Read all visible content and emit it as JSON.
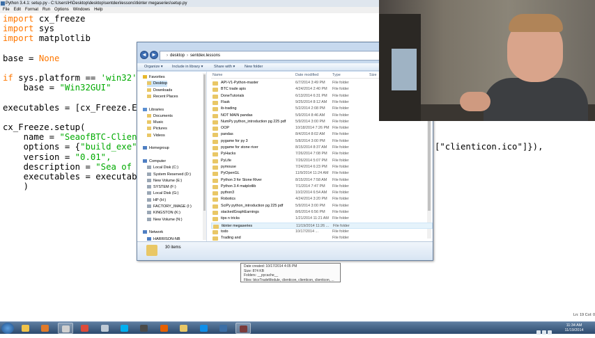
{
  "idle": {
    "title": "Python 3.4.1: setup.py - C:\\Users\\H\\Desktop\\desktop\\sentdex\\lessons\\tkinter megaseries\\setup.py",
    "menu": [
      "File",
      "Edit",
      "Format",
      "Run",
      "Options",
      "Windows",
      "Help"
    ],
    "code_lines": [
      {
        "kw": "import",
        "rest": " cx_freeze"
      },
      {
        "kw": "import",
        "rest": " sys"
      },
      {
        "kw": "import",
        "rest": " matplotlib"
      },
      {
        "kw": "",
        "rest": ""
      },
      {
        "kw": "",
        "rest": "base = ",
        "kw2": "None"
      },
      {
        "kw": "",
        "rest": ""
      },
      {
        "kw": "if",
        "rest": " sys.platform == ",
        "str": "'win32'"
      },
      {
        "kw": "",
        "rest": "    base = ",
        "str": "\"Win32GUI\""
      },
      {
        "kw": "",
        "rest": ""
      },
      {
        "kw": "",
        "rest": "executables = [cx_Freeze.E"
      },
      {
        "kw": "",
        "rest": ""
      },
      {
        "kw": "",
        "rest": "cx_Freeze.setup("
      },
      {
        "kw": "",
        "rest": "    name = ",
        "str": "\"SeaofBTC-Clien"
      },
      {
        "kw": "",
        "rest": "    options = {",
        "str": "\"build_exe\""
      },
      {
        "kw": "",
        "rest": "    version = ",
        "str": "\"0.01\","
      },
      {
        "kw": "",
        "rest": "    description = ",
        "str": "\"Sea of"
      },
      {
        "kw": "",
        "rest": "    executables = executab"
      },
      {
        "kw": "",
        "rest": "    )"
      }
    ],
    "code_extra": "[\"clienticon.ico\"]}),",
    "status_line": "Ln: 19 Col: 0"
  },
  "explorer": {
    "nav_back": "◄",
    "nav_fwd": "►",
    "address": [
      "desktop",
      "sentdex.lessons"
    ],
    "toolbar": [
      "Organize ▾",
      "Include in library ▾",
      "Share with ▾",
      "New folder"
    ],
    "nav_items": [
      {
        "label": "Favorites",
        "icon": "star-icon",
        "level": 0
      },
      {
        "label": "Desktop",
        "icon": "desktop-icon",
        "level": 1,
        "selected": true
      },
      {
        "label": "Downloads",
        "icon": "downloads-icon",
        "level": 1
      },
      {
        "label": "Recent Places",
        "icon": "recent-places-icon",
        "level": 1
      },
      {
        "label": "",
        "icon": "",
        "level": 0
      },
      {
        "label": "Libraries",
        "icon": "libraries-icon",
        "level": 0
      },
      {
        "label": "Documents",
        "icon": "documents-icon",
        "level": 1
      },
      {
        "label": "Music",
        "icon": "music-icon",
        "level": 1
      },
      {
        "label": "Pictures",
        "icon": "pictures-icon",
        "level": 1
      },
      {
        "label": "Videos",
        "icon": "videos-icon",
        "level": 1
      },
      {
        "label": "",
        "icon": "",
        "level": 0
      },
      {
        "label": "Homegroup",
        "icon": "homegroup-icon",
        "level": 0
      },
      {
        "label": "",
        "icon": "",
        "level": 0
      },
      {
        "label": "Computer",
        "icon": "computer-icon",
        "level": 0
      },
      {
        "label": "Local Disk (C:)",
        "icon": "drive-icon",
        "level": 1
      },
      {
        "label": "System Reserved (D:)",
        "icon": "drive-icon",
        "level": 1
      },
      {
        "label": "New Volume (E:)",
        "icon": "drive-icon",
        "level": 1
      },
      {
        "label": "SYSTEM (F:)",
        "icon": "drive-icon",
        "level": 1
      },
      {
        "label": "Local Disk (G:)",
        "icon": "drive-icon",
        "level": 1
      },
      {
        "label": "HP (H:)",
        "icon": "drive-icon",
        "level": 1
      },
      {
        "label": "FACTORY_IMAGE (I:)",
        "icon": "drive-icon",
        "level": 1
      },
      {
        "label": "KINGSTON (K:)",
        "icon": "drive-icon",
        "level": 1
      },
      {
        "label": "New Volume (N:)",
        "icon": "drive-icon",
        "level": 1
      },
      {
        "label": "",
        "icon": "",
        "level": 0
      },
      {
        "label": "Network",
        "icon": "network-icon",
        "level": 0
      },
      {
        "label": "HARRISON-NB",
        "icon": "computer-icon",
        "level": 1
      }
    ],
    "columns": {
      "name": "Name",
      "date": "Date modified",
      "type": "Type",
      "size": "Size"
    },
    "files": [
      {
        "name": "API-V1-Python-master",
        "date": "6/7/2014 3:49 PM",
        "type": "File folder"
      },
      {
        "name": "BTC trade apis",
        "date": "4/24/2014 2:40 PM",
        "type": "File folder"
      },
      {
        "name": "DoneTutorials",
        "date": "6/13/2014 6:31 PM",
        "type": "File folder"
      },
      {
        "name": "Flask",
        "date": "9/25/2014 8:12 AM",
        "type": "File folder"
      },
      {
        "name": "ib-trading",
        "date": "5/2/2014 2:08 PM",
        "type": "File folder"
      },
      {
        "name": "NOT MAIN pandas",
        "date": "5/9/2014 8:46 AM",
        "type": "File folder"
      },
      {
        "name": "NumPy python_introduction pg 225 pdf",
        "date": "5/9/2014 3:00 PM",
        "type": "File folder"
      },
      {
        "name": "OOP",
        "date": "10/18/2014 7:26 PM",
        "type": "File folder"
      },
      {
        "name": "pandas",
        "date": "8/4/2014 8:02 AM",
        "type": "File folder"
      },
      {
        "name": "pygame for py 3",
        "date": "5/8/2014 3:00 PM",
        "type": "File folder"
      },
      {
        "name": "pygame for stone river",
        "date": "8/15/2014 8:37 AM",
        "type": "File folder"
      },
      {
        "name": "PyHacks",
        "date": "7/26/2014 7:08 PM",
        "type": "File folder"
      },
      {
        "name": "PyLife",
        "date": "7/26/2014 5:07 PM",
        "type": "File folder"
      },
      {
        "name": "pymouse",
        "date": "7/24/2014 6:23 PM",
        "type": "File folder"
      },
      {
        "name": "PyOpenGL",
        "date": "11/9/2014 11:24 AM",
        "type": "File folder"
      },
      {
        "name": "Python 3 for Stone River",
        "date": "8/15/2014 7:58 AM",
        "type": "File folder"
      },
      {
        "name": "Python 3.4 matplotlib",
        "date": "7/1/2014 7:47 PM",
        "type": "File folder"
      },
      {
        "name": "python3",
        "date": "10/2/2014 6:54 AM",
        "type": "File folder"
      },
      {
        "name": "Robotics",
        "date": "4/24/2014 3:20 PM",
        "type": "File folder"
      },
      {
        "name": "SciPy python_introduction pg 225 pdf",
        "date": "5/9/2014 3:00 PM",
        "type": "File folder"
      },
      {
        "name": "stackedGraphEarnings",
        "date": "8/6/2014 6:56 PM",
        "type": "File folder"
      },
      {
        "name": "tips n tricks",
        "date": "1/21/2014 11:21 AM",
        "type": "File folder"
      },
      {
        "name": "tkinter megaseries",
        "date": "11/19/2014 11:26 ...",
        "type": "File folder",
        "hover": true
      },
      {
        "name": "todo",
        "date": "10/17/2014 ...",
        "type": "File folder"
      },
      {
        "name": "Trading and",
        "date": "",
        "type": "File folder"
      }
    ],
    "tooltip": [
      "Date created: 10/17/2014 4:05 PM",
      "Size: 874 KB",
      "Folders: __pycache__",
      "Files: btcxTradeModule, clienticon, clienticon, clienticon, ..."
    ],
    "item_count": "30 items"
  },
  "taskbar": {
    "icons": [
      "explorer-icon",
      "media-player-icon",
      "file-manager-icon",
      "chrome-icon",
      "notepad-icon",
      "skype-icon",
      "game-icon",
      "firefox-icon",
      "folder-icon",
      "teamviewer-icon",
      "python-icon",
      "idle-icon"
    ],
    "colors": [
      "#f1c34a",
      "#e07a2a",
      "#d0d0d0",
      "#dd4b39",
      "#bfcad6",
      "#00aff0",
      "#4a4a4a",
      "#e66000",
      "#e9c766",
      "#0e8ee9",
      "#3c6ea5",
      "#7a3b3b"
    ],
    "time": "11:34 AM",
    "date": "11/19/2014"
  }
}
